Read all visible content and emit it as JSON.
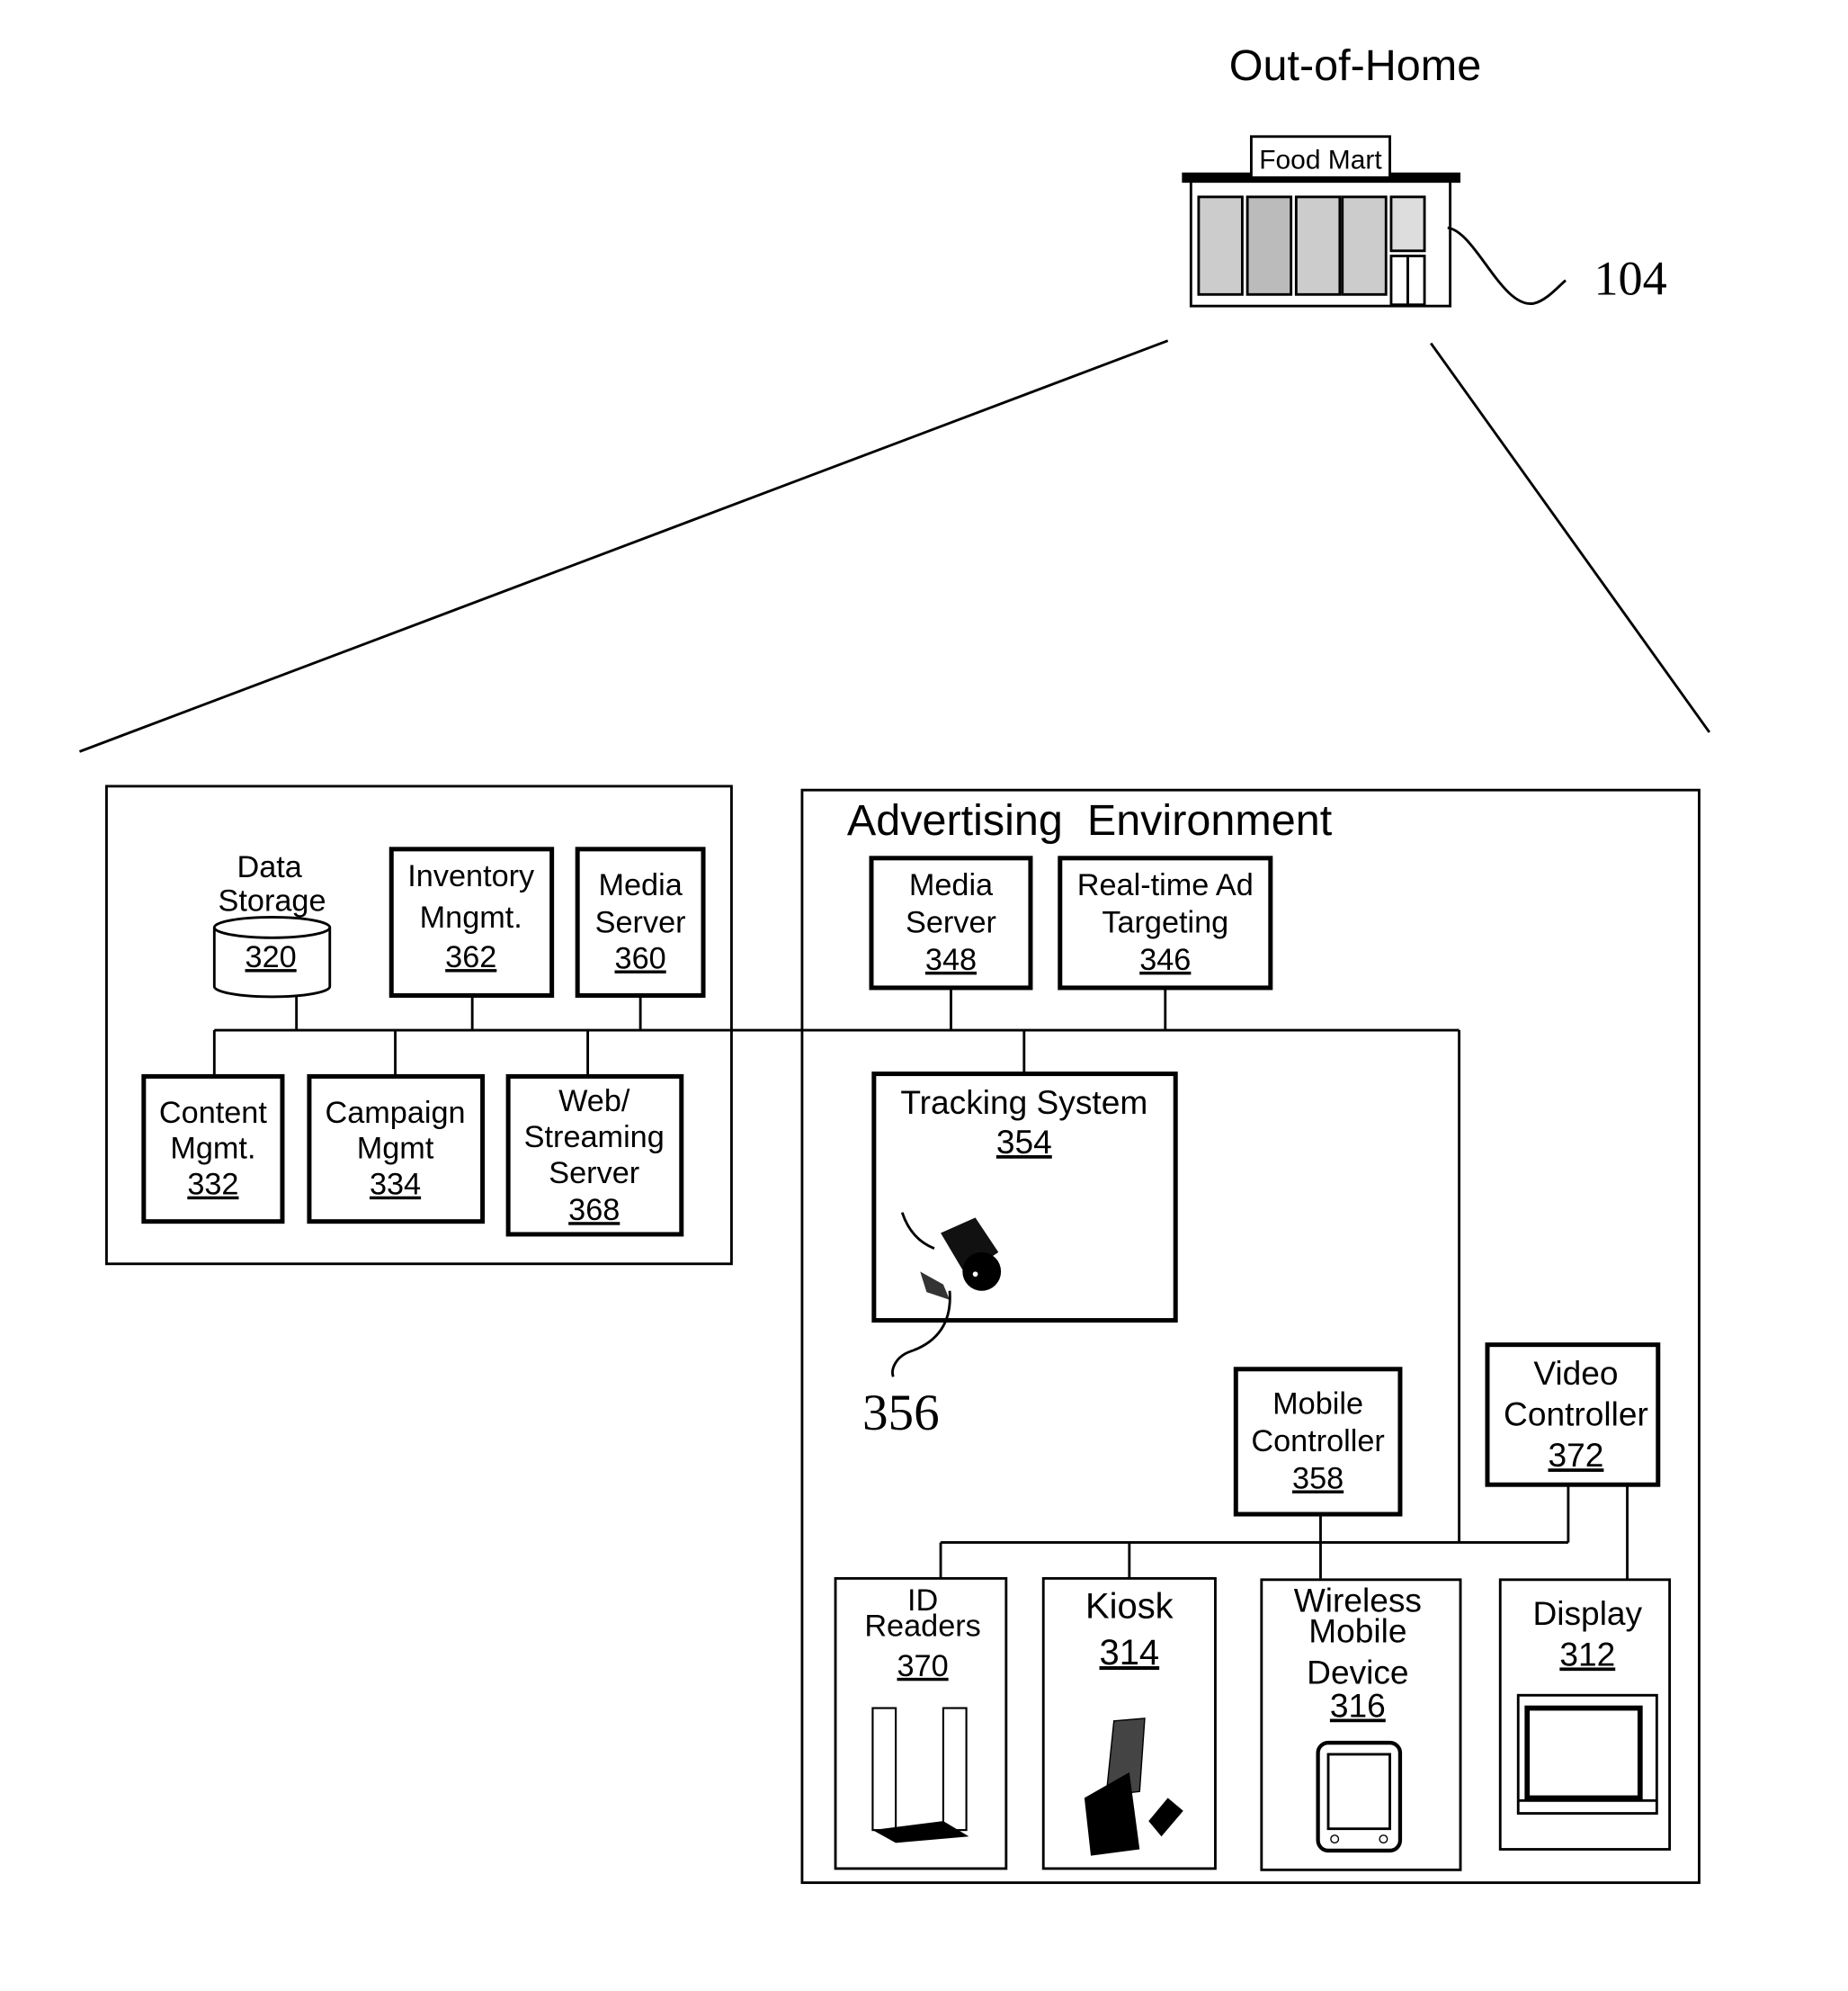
{
  "header": {
    "title": "Out-of-Home",
    "store_sign": "Food Mart",
    "store_ref": "104"
  },
  "left_group": {
    "data_storage": {
      "lines": [
        "Data",
        "Storage"
      ],
      "num": "320"
    },
    "inventory": {
      "lines": [
        "Inventory",
        "Mngmt."
      ],
      "num": "362"
    },
    "media_server": {
      "lines": [
        "Media",
        "Server"
      ],
      "num": "360"
    },
    "content": {
      "lines": [
        "Content",
        "Mgmt."
      ],
      "num": "332"
    },
    "campaign": {
      "lines": [
        "Campaign",
        "Mgmt"
      ],
      "num": "334"
    },
    "web_streaming": {
      "lines": [
        "Web/",
        "Streaming",
        "Server"
      ],
      "num": "368"
    }
  },
  "ad_env": {
    "title": "Advertising  Environment",
    "media_server": {
      "lines": [
        "Media",
        "Server"
      ],
      "num": "348"
    },
    "targeting": {
      "lines": [
        "Real-time Ad",
        "Targeting"
      ],
      "num": "346"
    },
    "tracking": {
      "lines": [
        "Tracking System"
      ],
      "num": "354"
    },
    "camera_ref": "356",
    "mobile_controller": {
      "lines": [
        "Mobile",
        "Controller"
      ],
      "num": "358"
    },
    "video_controller": {
      "lines": [
        "Video",
        "Controller"
      ],
      "num": "372"
    },
    "id_readers": {
      "lines": [
        "ID",
        "Readers"
      ],
      "num": "370"
    },
    "kiosk": {
      "lines": [
        "Kiosk"
      ],
      "num": "314"
    },
    "wireless": {
      "lines": [
        "Wireless",
        "Mobile",
        "Device"
      ],
      "num": "316"
    },
    "display": {
      "lines": [
        "Display"
      ],
      "num": "312"
    }
  }
}
